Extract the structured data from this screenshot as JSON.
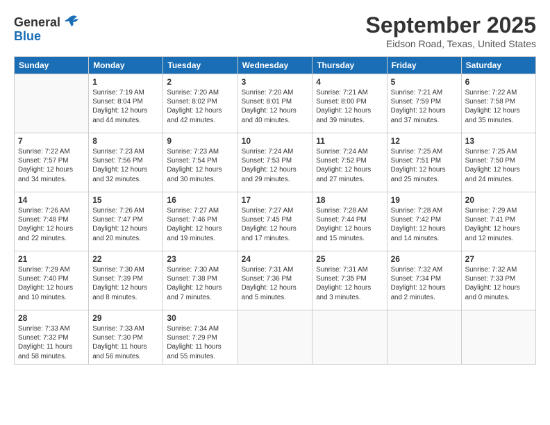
{
  "logo": {
    "line1": "General",
    "line2": "Blue"
  },
  "title": "September 2025",
  "location": "Eidson Road, Texas, United States",
  "days_of_week": [
    "Sunday",
    "Monday",
    "Tuesday",
    "Wednesday",
    "Thursday",
    "Friday",
    "Saturday"
  ],
  "weeks": [
    [
      {
        "day": "",
        "info": ""
      },
      {
        "day": "1",
        "info": "Sunrise: 7:19 AM\nSunset: 8:04 PM\nDaylight: 12 hours\nand 44 minutes."
      },
      {
        "day": "2",
        "info": "Sunrise: 7:20 AM\nSunset: 8:02 PM\nDaylight: 12 hours\nand 42 minutes."
      },
      {
        "day": "3",
        "info": "Sunrise: 7:20 AM\nSunset: 8:01 PM\nDaylight: 12 hours\nand 40 minutes."
      },
      {
        "day": "4",
        "info": "Sunrise: 7:21 AM\nSunset: 8:00 PM\nDaylight: 12 hours\nand 39 minutes."
      },
      {
        "day": "5",
        "info": "Sunrise: 7:21 AM\nSunset: 7:59 PM\nDaylight: 12 hours\nand 37 minutes."
      },
      {
        "day": "6",
        "info": "Sunrise: 7:22 AM\nSunset: 7:58 PM\nDaylight: 12 hours\nand 35 minutes."
      }
    ],
    [
      {
        "day": "7",
        "info": "Sunrise: 7:22 AM\nSunset: 7:57 PM\nDaylight: 12 hours\nand 34 minutes."
      },
      {
        "day": "8",
        "info": "Sunrise: 7:23 AM\nSunset: 7:56 PM\nDaylight: 12 hours\nand 32 minutes."
      },
      {
        "day": "9",
        "info": "Sunrise: 7:23 AM\nSunset: 7:54 PM\nDaylight: 12 hours\nand 30 minutes."
      },
      {
        "day": "10",
        "info": "Sunrise: 7:24 AM\nSunset: 7:53 PM\nDaylight: 12 hours\nand 29 minutes."
      },
      {
        "day": "11",
        "info": "Sunrise: 7:24 AM\nSunset: 7:52 PM\nDaylight: 12 hours\nand 27 minutes."
      },
      {
        "day": "12",
        "info": "Sunrise: 7:25 AM\nSunset: 7:51 PM\nDaylight: 12 hours\nand 25 minutes."
      },
      {
        "day": "13",
        "info": "Sunrise: 7:25 AM\nSunset: 7:50 PM\nDaylight: 12 hours\nand 24 minutes."
      }
    ],
    [
      {
        "day": "14",
        "info": "Sunrise: 7:26 AM\nSunset: 7:48 PM\nDaylight: 12 hours\nand 22 minutes."
      },
      {
        "day": "15",
        "info": "Sunrise: 7:26 AM\nSunset: 7:47 PM\nDaylight: 12 hours\nand 20 minutes."
      },
      {
        "day": "16",
        "info": "Sunrise: 7:27 AM\nSunset: 7:46 PM\nDaylight: 12 hours\nand 19 minutes."
      },
      {
        "day": "17",
        "info": "Sunrise: 7:27 AM\nSunset: 7:45 PM\nDaylight: 12 hours\nand 17 minutes."
      },
      {
        "day": "18",
        "info": "Sunrise: 7:28 AM\nSunset: 7:44 PM\nDaylight: 12 hours\nand 15 minutes."
      },
      {
        "day": "19",
        "info": "Sunrise: 7:28 AM\nSunset: 7:42 PM\nDaylight: 12 hours\nand 14 minutes."
      },
      {
        "day": "20",
        "info": "Sunrise: 7:29 AM\nSunset: 7:41 PM\nDaylight: 12 hours\nand 12 minutes."
      }
    ],
    [
      {
        "day": "21",
        "info": "Sunrise: 7:29 AM\nSunset: 7:40 PM\nDaylight: 12 hours\nand 10 minutes."
      },
      {
        "day": "22",
        "info": "Sunrise: 7:30 AM\nSunset: 7:39 PM\nDaylight: 12 hours\nand 8 minutes."
      },
      {
        "day": "23",
        "info": "Sunrise: 7:30 AM\nSunset: 7:38 PM\nDaylight: 12 hours\nand 7 minutes."
      },
      {
        "day": "24",
        "info": "Sunrise: 7:31 AM\nSunset: 7:36 PM\nDaylight: 12 hours\nand 5 minutes."
      },
      {
        "day": "25",
        "info": "Sunrise: 7:31 AM\nSunset: 7:35 PM\nDaylight: 12 hours\nand 3 minutes."
      },
      {
        "day": "26",
        "info": "Sunrise: 7:32 AM\nSunset: 7:34 PM\nDaylight: 12 hours\nand 2 minutes."
      },
      {
        "day": "27",
        "info": "Sunrise: 7:32 AM\nSunset: 7:33 PM\nDaylight: 12 hours\nand 0 minutes."
      }
    ],
    [
      {
        "day": "28",
        "info": "Sunrise: 7:33 AM\nSunset: 7:32 PM\nDaylight: 11 hours\nand 58 minutes."
      },
      {
        "day": "29",
        "info": "Sunrise: 7:33 AM\nSunset: 7:30 PM\nDaylight: 11 hours\nand 56 minutes."
      },
      {
        "day": "30",
        "info": "Sunrise: 7:34 AM\nSunset: 7:29 PM\nDaylight: 11 hours\nand 55 minutes."
      },
      {
        "day": "",
        "info": ""
      },
      {
        "day": "",
        "info": ""
      },
      {
        "day": "",
        "info": ""
      },
      {
        "day": "",
        "info": ""
      }
    ]
  ]
}
